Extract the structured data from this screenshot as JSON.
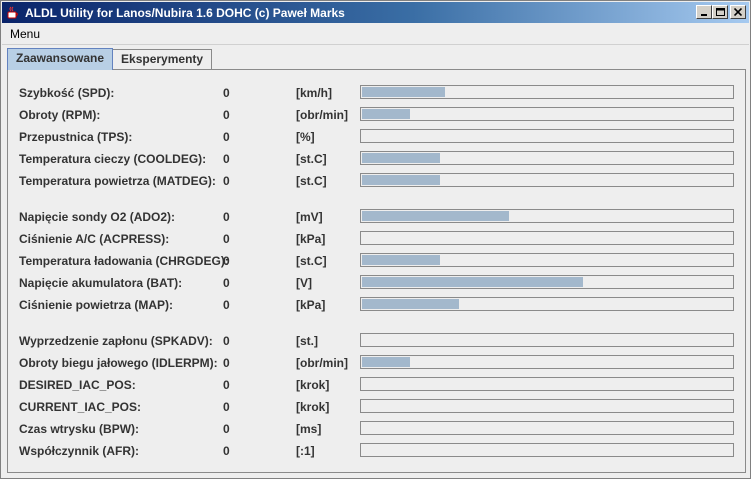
{
  "window": {
    "title": "ALDL Utility for Lanos/Nubira 1.6 DOHC (c) Paweł Marks",
    "minimize": "_",
    "maximize": "□",
    "close": "✕"
  },
  "menu": {
    "items": [
      "Menu"
    ]
  },
  "tabs": [
    {
      "label": "Zaawansowane",
      "active": true
    },
    {
      "label": "Eksperymenty",
      "active": false
    }
  ],
  "rows": [
    {
      "label": "Szybkość (SPD):",
      "value": "0",
      "unit": "[km/h]",
      "level": 0.225
    },
    {
      "label": "Obroty (RPM):",
      "value": "0",
      "unit": "[obr/min]",
      "level": 0.13
    },
    {
      "label": "Przepustnica (TPS):",
      "value": "0",
      "unit": "[%]",
      "level": 0
    },
    {
      "label": "Temperatura cieczy (COOLDEG):",
      "value": "0",
      "unit": "[st.C]",
      "level": 0.21
    },
    {
      "label": "Temperatura powietrza (MATDEG):",
      "value": "0",
      "unit": "[st.C]",
      "level": 0.21
    },
    {
      "label": "Napięcie sondy O2 (ADO2):",
      "value": "0",
      "unit": "[mV]",
      "level": 0.397
    },
    {
      "label": "Ciśnienie A/C (ACPRESS):",
      "value": "0",
      "unit": "[kPa]",
      "level": 0
    },
    {
      "label": "Temperatura ładowania (CHRGDEG):",
      "value": "0",
      "unit": "[st.C]",
      "level": 0.21
    },
    {
      "label": "Napięcie akumulatora (BAT):",
      "value": "0",
      "unit": "[V]",
      "level": 0.597
    },
    {
      "label": "Ciśnienie powietrza (MAP):",
      "value": "0",
      "unit": "[kPa]",
      "level": 0.263
    },
    {
      "label": "Wyprzedzenie zapłonu (SPKADV):",
      "value": "0",
      "unit": "[st.]",
      "level": 0
    },
    {
      "label": "Obroty biegu jałowego (IDLERPM):",
      "value": "0",
      "unit": "[obr/min]",
      "level": 0.13
    },
    {
      "label": "DESIRED_IAC_POS:",
      "value": "0",
      "unit": "[krok]",
      "level": 0
    },
    {
      "label": "CURRENT_IAC_POS:",
      "value": "0",
      "unit": "[krok]",
      "level": 0
    },
    {
      "label": "Czas wtrysku (BPW):",
      "value": "0",
      "unit": "[ms]",
      "level": 0
    },
    {
      "label": "Współczynnik (AFR):",
      "value": "0",
      "unit": "[:1]",
      "level": 0
    }
  ],
  "colors": {
    "bar_fill": "#a3b8cc",
    "active_tab": "#b8cfe5"
  }
}
